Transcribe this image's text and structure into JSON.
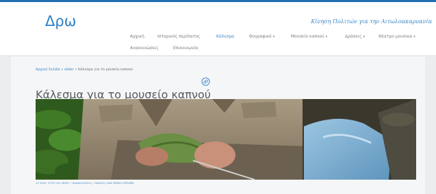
{
  "site": {
    "logo": "Δρω",
    "tagline": "Κίνηση Πολιτών για την Αιτωλοακαρνανία"
  },
  "nav": {
    "items": [
      {
        "label": "Αρχική",
        "dropdown": false,
        "active": false
      },
      {
        "label": "Ιστορικός περίπατος",
        "dropdown": false,
        "active": false
      },
      {
        "label": "Κάλεσμα",
        "dropdown": false,
        "active": true
      },
      {
        "label": "Θυγραφικό",
        "dropdown": true,
        "active": false
      },
      {
        "label": "Μουσείο καπνού",
        "dropdown": true,
        "active": false
      },
      {
        "label": "Δράσεις",
        "dropdown": true,
        "active": false
      },
      {
        "label": "Θέατρο μουσικα",
        "dropdown": true,
        "active": false
      },
      {
        "label": "Ανακοινώσεις",
        "dropdown": false,
        "active": false
      },
      {
        "label": "Επικοινωνία",
        "dropdown": false,
        "active": false
      }
    ],
    "dropdown_glyph": "▾"
  },
  "breadcrumb": {
    "home": "Αρχική Σελίδα",
    "sep1": "»",
    "section": "slider",
    "sep2": "»",
    "current": "Κάλεσμα για το μουσείο καπνού"
  },
  "page": {
    "title": "Κάλεσμα για το μουσείο καπνού",
    "title_icon": "link-icon",
    "image_alt": "man-threading-tobacco-leaves"
  },
  "meta": {
    "date": "23 Ιουλ, 2016",
    "in_label": "στο",
    "category1": "slider",
    "sep": "/",
    "category2": "Ανακοινώσεις",
    "category3": "Δράσεις Από Makes Ελλάδα"
  },
  "colors": {
    "accent": "#1e6fb0",
    "link": "#3d88c8",
    "text": "#555a60"
  }
}
